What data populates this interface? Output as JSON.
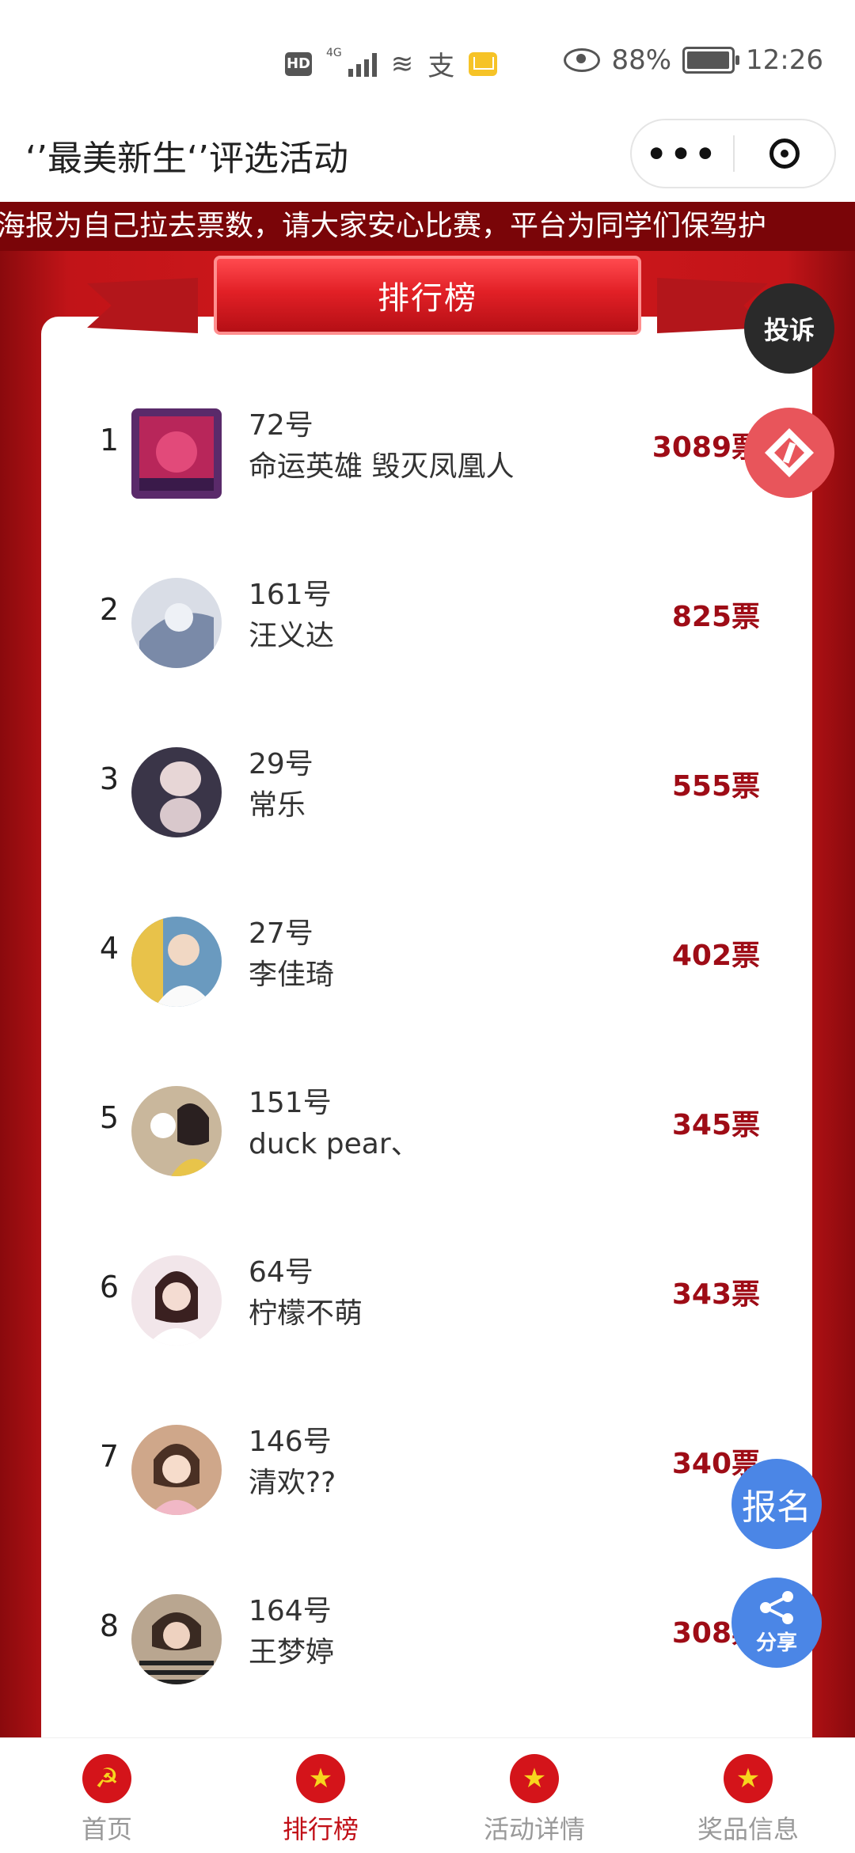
{
  "status_bar": {
    "battery": "88%",
    "time": "12:26",
    "network": "4G"
  },
  "title_bar": {
    "title": "‘’最美新生‘’评选活动"
  },
  "marquee": {
    "text": "享海报为自己拉去票数，请大家安心比赛，平台为同学们保驾护"
  },
  "banner": {
    "title": "排行榜"
  },
  "floating": {
    "complain": "投诉",
    "signup": "报名",
    "share": "分享"
  },
  "rankings": [
    {
      "rank": "1",
      "entry": "72号",
      "name": "命运英雄 毁灭凤凰人",
      "votes": "3089票"
    },
    {
      "rank": "2",
      "entry": "161号",
      "name": "汪义达",
      "votes": "825票"
    },
    {
      "rank": "3",
      "entry": "29号",
      "name": "常乐",
      "votes": "555票"
    },
    {
      "rank": "4",
      "entry": "27号",
      "name": "李佳琦",
      "votes": "402票"
    },
    {
      "rank": "5",
      "entry": "151号",
      "name": "duck pear、",
      "votes": "345票"
    },
    {
      "rank": "6",
      "entry": "64号",
      "name": "柠檬不萌",
      "votes": "343票"
    },
    {
      "rank": "7",
      "entry": "146号",
      "name": "清欢??",
      "votes": "340票"
    },
    {
      "rank": "8",
      "entry": "164号",
      "name": "王梦婷",
      "votes": "308票"
    }
  ],
  "tabs": [
    {
      "label": "首页",
      "icon": "party-emblem-icon",
      "active": false
    },
    {
      "label": "排行榜",
      "icon": "star-icon",
      "active": true
    },
    {
      "label": "活动详情",
      "icon": "flag-icon",
      "active": false
    },
    {
      "label": "奖品信息",
      "icon": "flag-icon",
      "active": false
    }
  ],
  "colors": {
    "primary_red": "#d5191d",
    "vote_red": "#9e0c16",
    "float_blue": "#4b86e6"
  }
}
